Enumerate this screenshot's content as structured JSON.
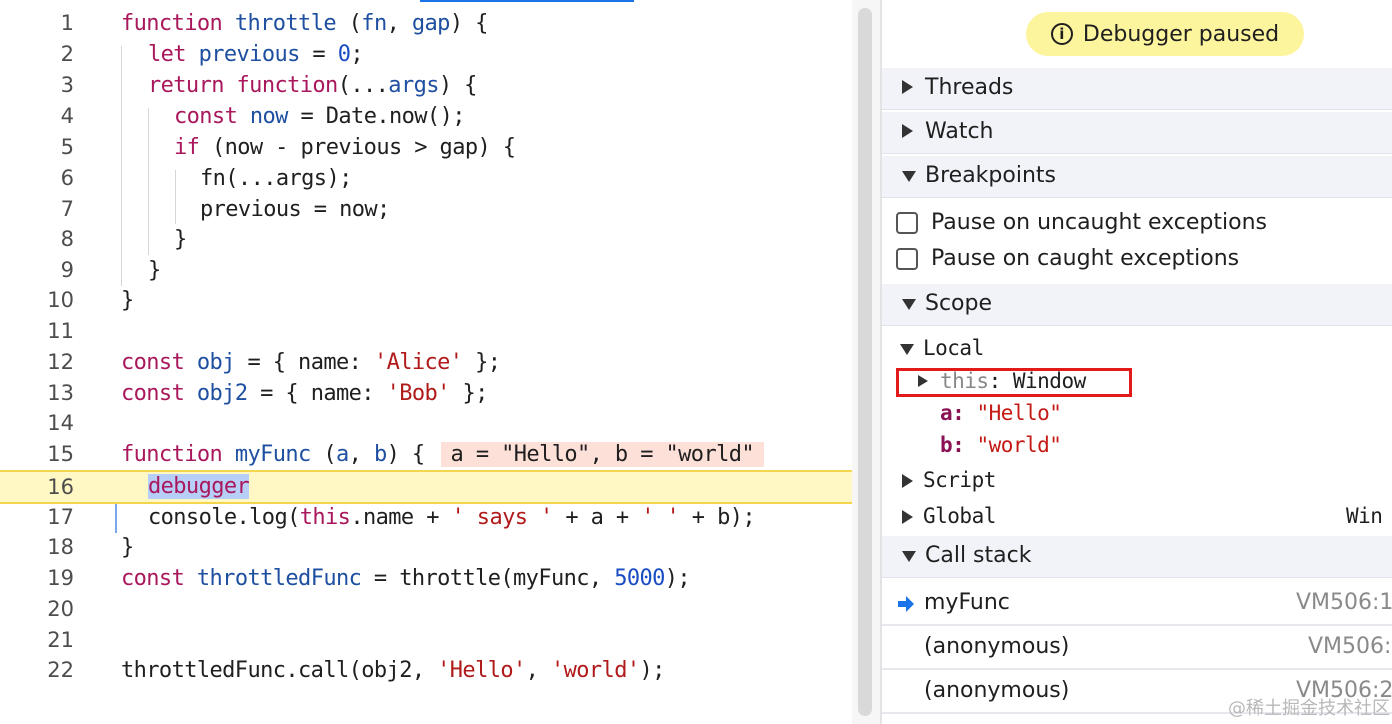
{
  "editor": {
    "lines": [
      {
        "num": "1"
      },
      {
        "num": "2"
      },
      {
        "num": "3"
      },
      {
        "num": "4"
      },
      {
        "num": "5"
      },
      {
        "num": "6"
      },
      {
        "num": "7"
      },
      {
        "num": "8"
      },
      {
        "num": "9"
      },
      {
        "num": "10"
      },
      {
        "num": "11"
      },
      {
        "num": "12"
      },
      {
        "num": "13"
      },
      {
        "num": "14"
      },
      {
        "num": "15"
      },
      {
        "num": "16"
      },
      {
        "num": "17"
      },
      {
        "num": "18"
      },
      {
        "num": "19"
      },
      {
        "num": "20"
      },
      {
        "num": "21"
      },
      {
        "num": "22"
      }
    ],
    "code": {
      "l1": [
        "function",
        " ",
        "throttle",
        " (",
        "fn",
        ", ",
        "gap",
        ") {"
      ],
      "l2": [
        "let",
        " ",
        "previous",
        " = ",
        "0",
        ";"
      ],
      "l3": [
        "return",
        " ",
        "function",
        "(...",
        "args",
        ") {"
      ],
      "l4": [
        "const",
        " ",
        "now",
        " = Date.now();"
      ],
      "l5": [
        "if",
        " (now - previous > gap) {"
      ],
      "l6": [
        "fn(...args);"
      ],
      "l7": [
        "previous = now;"
      ],
      "l8": [
        "}"
      ],
      "l9": [
        "}"
      ],
      "l10": [
        "}"
      ],
      "l12": [
        "const",
        " ",
        "obj",
        " = { name: ",
        "'Alice'",
        " };"
      ],
      "l13": [
        "const",
        " ",
        "obj2",
        " = { name: ",
        "'Bob'",
        " };"
      ],
      "l15": [
        "function",
        " ",
        "myFunc",
        " (",
        "a",
        ", ",
        "b",
        ") {"
      ],
      "l15_inline": "a = \"Hello\", b = \"world\"",
      "l16": [
        "debugger"
      ],
      "l17": [
        "console.log(",
        "this",
        ".name + ",
        "' says '",
        " + a + ",
        "' '",
        " + b);"
      ],
      "l18": [
        "}"
      ],
      "l19": [
        "const",
        " ",
        "throttledFunc",
        " = throttle(myFunc, ",
        "5000",
        ");"
      ],
      "l22": [
        "throttledFunc.call(obj2, ",
        "'Hello'",
        ", ",
        "'world'",
        ");"
      ]
    }
  },
  "debugger": {
    "status": "Debugger paused",
    "status_icon": "info-icon",
    "sections": {
      "threads": "Threads",
      "watch": "Watch",
      "breakpoints": "Breakpoints",
      "scope": "Scope",
      "call_stack": "Call stack"
    },
    "breakpoint_options": [
      {
        "label": "Pause on uncaught exceptions",
        "checked": false
      },
      {
        "label": "Pause on caught exceptions",
        "checked": false
      }
    ],
    "scope": {
      "local_label": "Local",
      "this_key": "this",
      "this_value": "Window",
      "props": [
        {
          "key": "a",
          "value": "\"Hello\""
        },
        {
          "key": "b",
          "value": "\"world\""
        }
      ],
      "script_label": "Script",
      "global_label": "Global",
      "global_value": "Win"
    },
    "call_stack": [
      {
        "name": "myFunc",
        "location": "VM506:1",
        "current": true
      },
      {
        "name": "(anonymous)",
        "location": "VM506:",
        "current": false
      },
      {
        "name": "(anonymous)",
        "location": "VM506:2",
        "current": false
      }
    ]
  },
  "watermark": "@稀土掘金技术社区",
  "colors": {
    "keyword": "#a9185c",
    "identifier": "#1e4fa0",
    "string": "#b01a1a",
    "number": "#1a4cc4",
    "paused_line": "#fff8c4",
    "status_pill": "#fdf49e",
    "highlight_box": "#e31a1a"
  }
}
